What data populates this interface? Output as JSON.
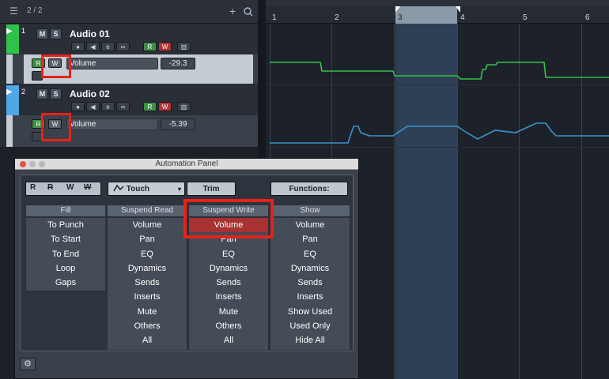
{
  "tracklist": {
    "track_count": "2 / 2",
    "tracks": [
      {
        "number": "1",
        "name": "Audio 01",
        "mute": "M",
        "solo": "S",
        "read": "R",
        "write": "W",
        "param": "Volume",
        "value": "-29.3",
        "color": "#2fc24a"
      },
      {
        "number": "2",
        "name": "Audio 02",
        "mute": "M",
        "solo": "S",
        "read": "R",
        "write": "W",
        "param": "Volume",
        "value": "-5.39",
        "color": "#4fa7e3"
      }
    ],
    "icons": [
      "list-icon",
      "plus-icon",
      "search-icon",
      "record-icon",
      "monitor-icon",
      "edit-icon",
      "link-icon",
      "inserts-icon"
    ]
  },
  "ruler": {
    "bars": [
      "1",
      "2",
      "3",
      "4",
      "5",
      "6"
    ]
  },
  "automation_colors": {
    "track1": "#35c04a",
    "track2": "#3d92c9"
  },
  "panel": {
    "title": "Automation Panel",
    "mode_buttons": [
      "R",
      "W"
    ],
    "mode": "Touch",
    "trim": "Trim",
    "functions": "Functions:",
    "columns": [
      {
        "header": "Fill",
        "items": [
          "To Punch",
          "To Start",
          "To End",
          "Loop",
          "Gaps"
        ]
      },
      {
        "header": "Suspend Read",
        "items": [
          "Volume",
          "Pan",
          "EQ",
          "Dynamics",
          "Sends",
          "Inserts",
          "Mute",
          "Others",
          "All"
        ]
      },
      {
        "header": "Suspend Write",
        "items": [
          "Volume",
          "Pan",
          "EQ",
          "Dynamics",
          "Sends",
          "Inserts",
          "Mute",
          "Others",
          "All"
        ]
      },
      {
        "header": "Show",
        "items": [
          "Volume",
          "Pan",
          "EQ",
          "Dynamics",
          "Sends",
          "Inserts",
          "Show Used",
          "Used Only",
          "Hide All"
        ]
      }
    ]
  }
}
